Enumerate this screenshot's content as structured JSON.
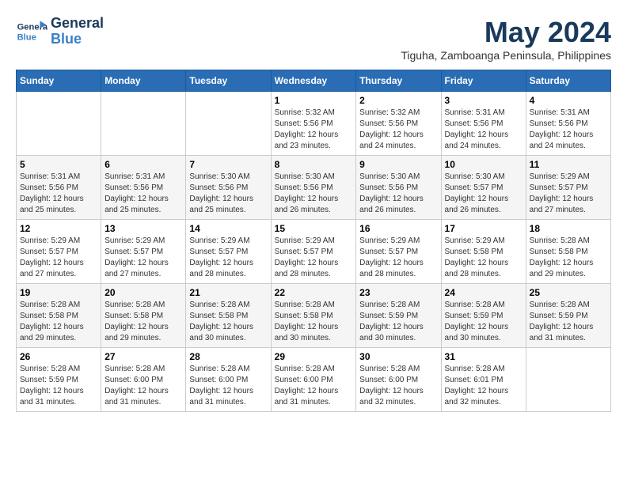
{
  "header": {
    "logo": {
      "line1": "General",
      "line2": "Blue"
    },
    "title": "May 2024",
    "subtitle": "Tiguha, Zamboanga Peninsula, Philippines"
  },
  "calendar": {
    "weekdays": [
      "Sunday",
      "Monday",
      "Tuesday",
      "Wednesday",
      "Thursday",
      "Friday",
      "Saturday"
    ],
    "weeks": [
      [
        {
          "day": "",
          "sunrise": "",
          "sunset": "",
          "daylight": ""
        },
        {
          "day": "",
          "sunrise": "",
          "sunset": "",
          "daylight": ""
        },
        {
          "day": "",
          "sunrise": "",
          "sunset": "",
          "daylight": ""
        },
        {
          "day": "1",
          "sunrise": "Sunrise: 5:32 AM",
          "sunset": "Sunset: 5:56 PM",
          "daylight": "Daylight: 12 hours and 23 minutes."
        },
        {
          "day": "2",
          "sunrise": "Sunrise: 5:32 AM",
          "sunset": "Sunset: 5:56 PM",
          "daylight": "Daylight: 12 hours and 24 minutes."
        },
        {
          "day": "3",
          "sunrise": "Sunrise: 5:31 AM",
          "sunset": "Sunset: 5:56 PM",
          "daylight": "Daylight: 12 hours and 24 minutes."
        },
        {
          "day": "4",
          "sunrise": "Sunrise: 5:31 AM",
          "sunset": "Sunset: 5:56 PM",
          "daylight": "Daylight: 12 hours and 24 minutes."
        }
      ],
      [
        {
          "day": "5",
          "sunrise": "Sunrise: 5:31 AM",
          "sunset": "Sunset: 5:56 PM",
          "daylight": "Daylight: 12 hours and 25 minutes."
        },
        {
          "day": "6",
          "sunrise": "Sunrise: 5:31 AM",
          "sunset": "Sunset: 5:56 PM",
          "daylight": "Daylight: 12 hours and 25 minutes."
        },
        {
          "day": "7",
          "sunrise": "Sunrise: 5:30 AM",
          "sunset": "Sunset: 5:56 PM",
          "daylight": "Daylight: 12 hours and 25 minutes."
        },
        {
          "day": "8",
          "sunrise": "Sunrise: 5:30 AM",
          "sunset": "Sunset: 5:56 PM",
          "daylight": "Daylight: 12 hours and 26 minutes."
        },
        {
          "day": "9",
          "sunrise": "Sunrise: 5:30 AM",
          "sunset": "Sunset: 5:56 PM",
          "daylight": "Daylight: 12 hours and 26 minutes."
        },
        {
          "day": "10",
          "sunrise": "Sunrise: 5:30 AM",
          "sunset": "Sunset: 5:57 PM",
          "daylight": "Daylight: 12 hours and 26 minutes."
        },
        {
          "day": "11",
          "sunrise": "Sunrise: 5:29 AM",
          "sunset": "Sunset: 5:57 PM",
          "daylight": "Daylight: 12 hours and 27 minutes."
        }
      ],
      [
        {
          "day": "12",
          "sunrise": "Sunrise: 5:29 AM",
          "sunset": "Sunset: 5:57 PM",
          "daylight": "Daylight: 12 hours and 27 minutes."
        },
        {
          "day": "13",
          "sunrise": "Sunrise: 5:29 AM",
          "sunset": "Sunset: 5:57 PM",
          "daylight": "Daylight: 12 hours and 27 minutes."
        },
        {
          "day": "14",
          "sunrise": "Sunrise: 5:29 AM",
          "sunset": "Sunset: 5:57 PM",
          "daylight": "Daylight: 12 hours and 28 minutes."
        },
        {
          "day": "15",
          "sunrise": "Sunrise: 5:29 AM",
          "sunset": "Sunset: 5:57 PM",
          "daylight": "Daylight: 12 hours and 28 minutes."
        },
        {
          "day": "16",
          "sunrise": "Sunrise: 5:29 AM",
          "sunset": "Sunset: 5:57 PM",
          "daylight": "Daylight: 12 hours and 28 minutes."
        },
        {
          "day": "17",
          "sunrise": "Sunrise: 5:29 AM",
          "sunset": "Sunset: 5:58 PM",
          "daylight": "Daylight: 12 hours and 28 minutes."
        },
        {
          "day": "18",
          "sunrise": "Sunrise: 5:28 AM",
          "sunset": "Sunset: 5:58 PM",
          "daylight": "Daylight: 12 hours and 29 minutes."
        }
      ],
      [
        {
          "day": "19",
          "sunrise": "Sunrise: 5:28 AM",
          "sunset": "Sunset: 5:58 PM",
          "daylight": "Daylight: 12 hours and 29 minutes."
        },
        {
          "day": "20",
          "sunrise": "Sunrise: 5:28 AM",
          "sunset": "Sunset: 5:58 PM",
          "daylight": "Daylight: 12 hours and 29 minutes."
        },
        {
          "day": "21",
          "sunrise": "Sunrise: 5:28 AM",
          "sunset": "Sunset: 5:58 PM",
          "daylight": "Daylight: 12 hours and 30 minutes."
        },
        {
          "day": "22",
          "sunrise": "Sunrise: 5:28 AM",
          "sunset": "Sunset: 5:58 PM",
          "daylight": "Daylight: 12 hours and 30 minutes."
        },
        {
          "day": "23",
          "sunrise": "Sunrise: 5:28 AM",
          "sunset": "Sunset: 5:59 PM",
          "daylight": "Daylight: 12 hours and 30 minutes."
        },
        {
          "day": "24",
          "sunrise": "Sunrise: 5:28 AM",
          "sunset": "Sunset: 5:59 PM",
          "daylight": "Daylight: 12 hours and 30 minutes."
        },
        {
          "day": "25",
          "sunrise": "Sunrise: 5:28 AM",
          "sunset": "Sunset: 5:59 PM",
          "daylight": "Daylight: 12 hours and 31 minutes."
        }
      ],
      [
        {
          "day": "26",
          "sunrise": "Sunrise: 5:28 AM",
          "sunset": "Sunset: 5:59 PM",
          "daylight": "Daylight: 12 hours and 31 minutes."
        },
        {
          "day": "27",
          "sunrise": "Sunrise: 5:28 AM",
          "sunset": "Sunset: 6:00 PM",
          "daylight": "Daylight: 12 hours and 31 minutes."
        },
        {
          "day": "28",
          "sunrise": "Sunrise: 5:28 AM",
          "sunset": "Sunset: 6:00 PM",
          "daylight": "Daylight: 12 hours and 31 minutes."
        },
        {
          "day": "29",
          "sunrise": "Sunrise: 5:28 AM",
          "sunset": "Sunset: 6:00 PM",
          "daylight": "Daylight: 12 hours and 31 minutes."
        },
        {
          "day": "30",
          "sunrise": "Sunrise: 5:28 AM",
          "sunset": "Sunset: 6:00 PM",
          "daylight": "Daylight: 12 hours and 32 minutes."
        },
        {
          "day": "31",
          "sunrise": "Sunrise: 5:28 AM",
          "sunset": "Sunset: 6:01 PM",
          "daylight": "Daylight: 12 hours and 32 minutes."
        },
        {
          "day": "",
          "sunrise": "",
          "sunset": "",
          "daylight": ""
        }
      ]
    ]
  }
}
